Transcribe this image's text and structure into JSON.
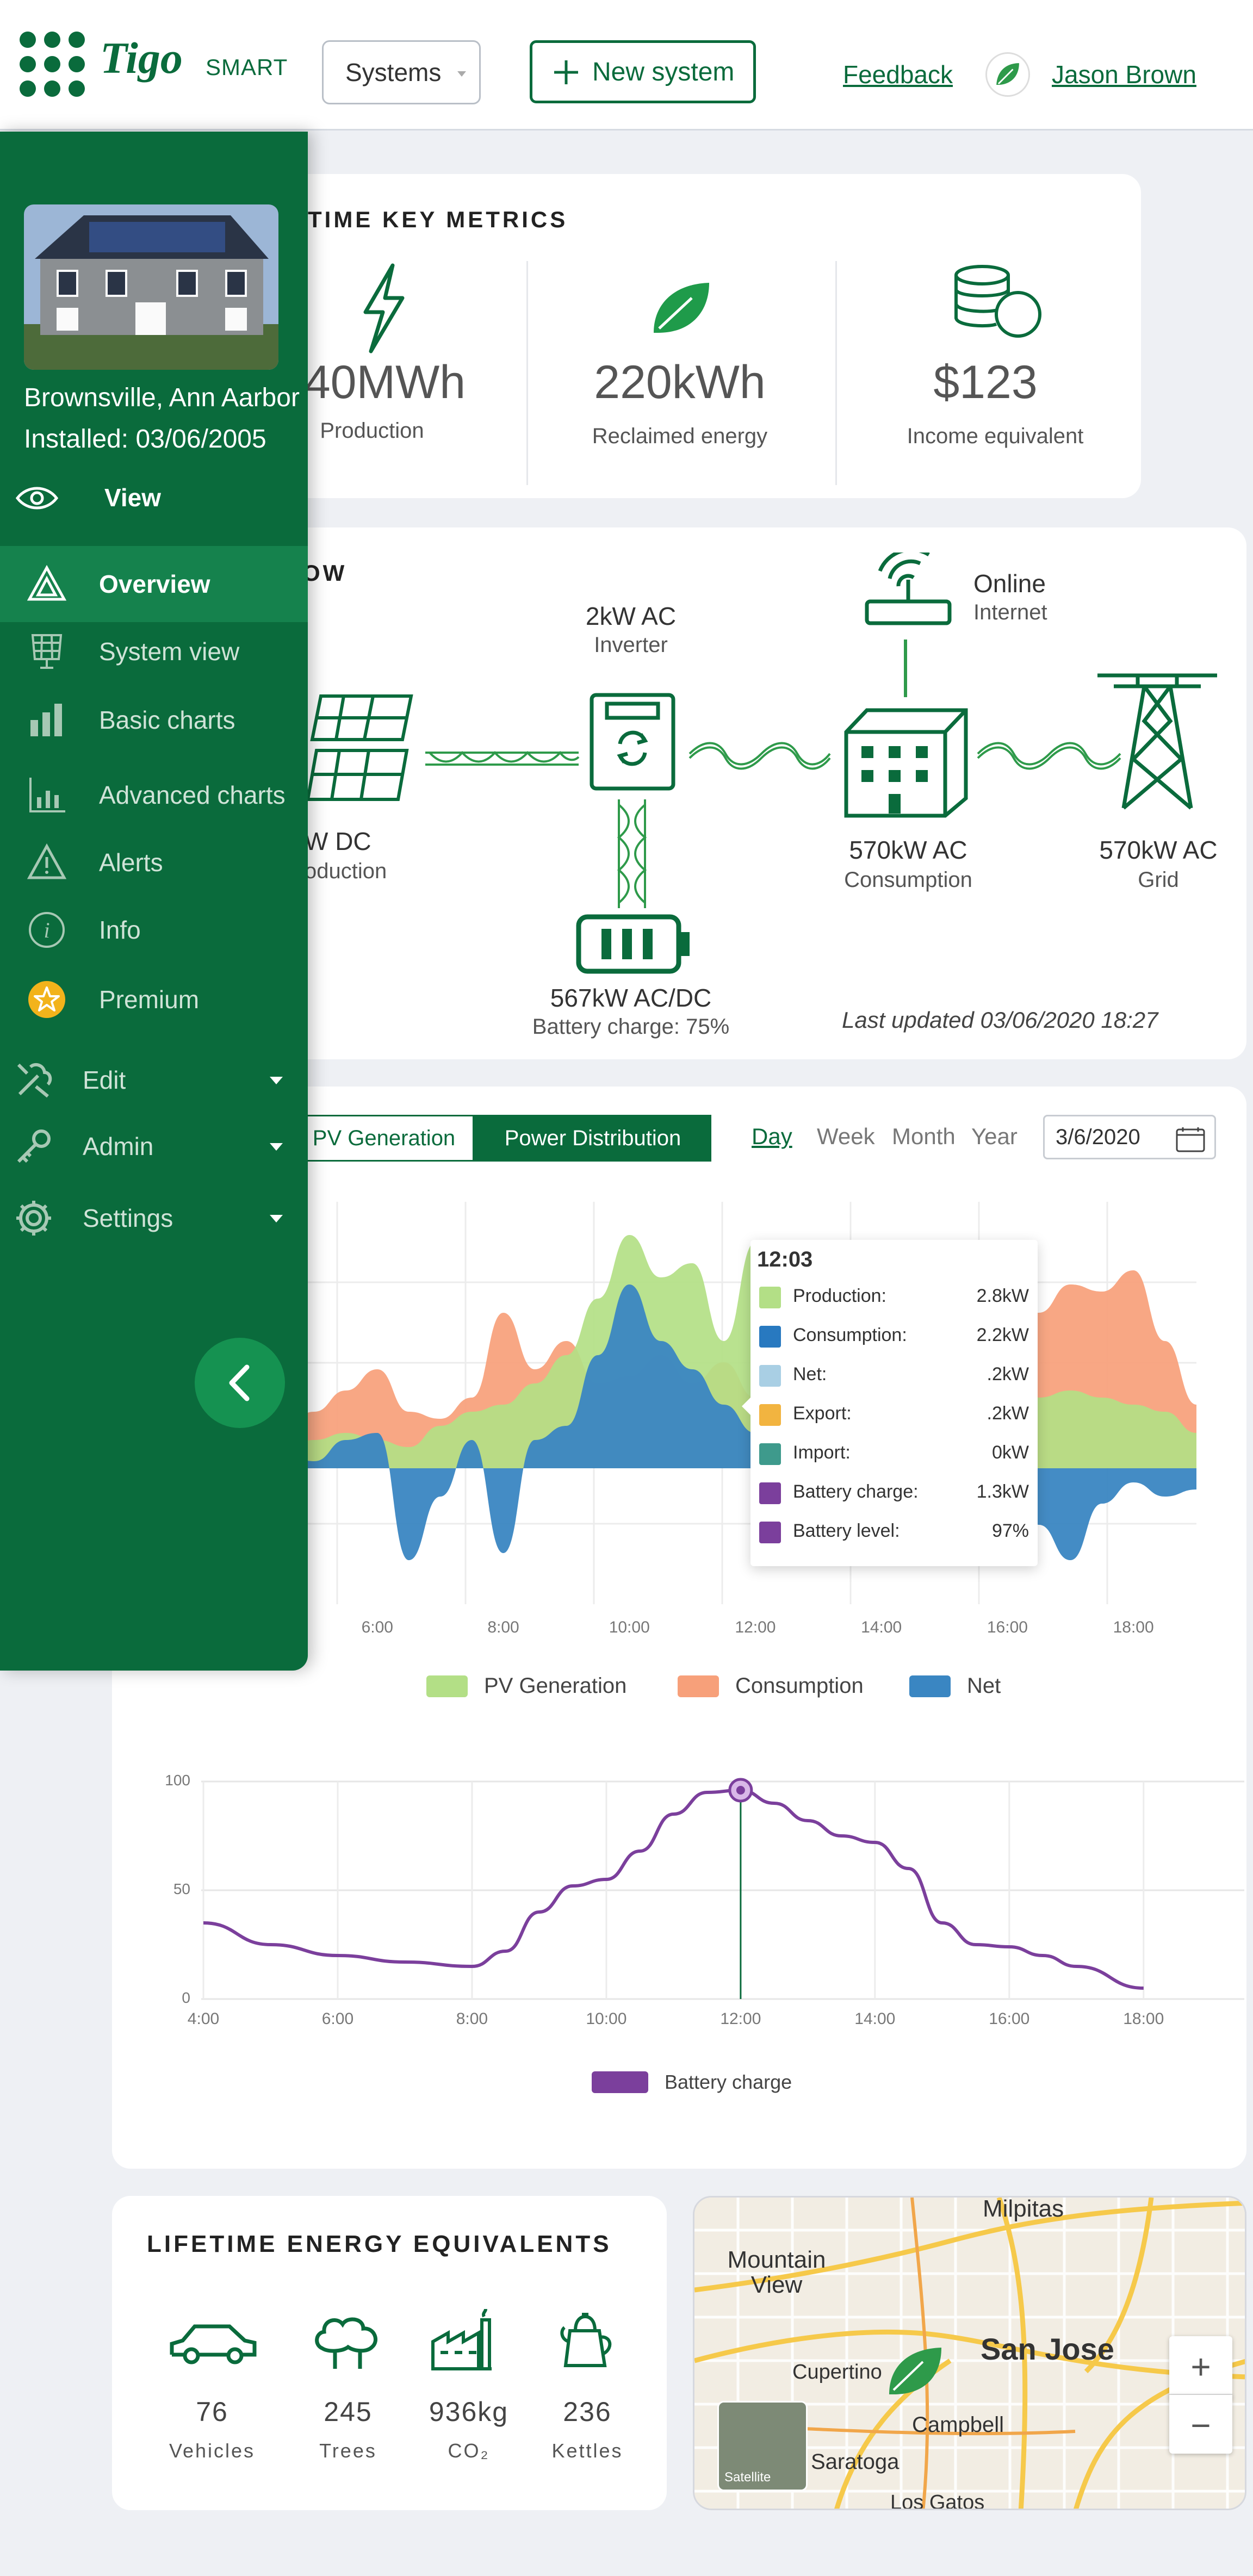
{
  "header": {
    "brand": "Tigo",
    "brand_sub": "SMART",
    "systems_label": "Systems",
    "new_system_label": "New system",
    "feedback_label": "Feedback",
    "user_name": "Jason Brown"
  },
  "sidebar": {
    "location": "Brownsville, Ann Aarbor",
    "installed": "Installed: 03/06/2005",
    "view_label": "View",
    "items": [
      {
        "label": "Overview",
        "icon": "overview-icon",
        "active": true
      },
      {
        "label": "System view",
        "icon": "solar-panel-icon"
      },
      {
        "label": "Basic charts",
        "icon": "bar-chart-icon"
      },
      {
        "label": "Advanced charts",
        "icon": "advanced-chart-icon"
      },
      {
        "label": "Alerts",
        "icon": "warning-icon"
      },
      {
        "label": "Info",
        "icon": "info-icon"
      },
      {
        "label": "Premium",
        "icon": "star-icon"
      },
      {
        "label": "Edit",
        "icon": "tools-icon",
        "dropdown": true
      },
      {
        "label": "Admin",
        "icon": "key-icon",
        "dropdown": true
      },
      {
        "label": "Settings",
        "icon": "gear-icon",
        "dropdown": true
      }
    ]
  },
  "metrics": {
    "title": "TIME KEY METRICS",
    "items": [
      {
        "value": "40MWh",
        "label": "Production",
        "icon": "lightning-icon"
      },
      {
        "value": "220kWh",
        "label": "Reclaimed energy",
        "icon": "leaf-icon"
      },
      {
        "value": "$123",
        "label": "Income equivalent",
        "icon": "coins-icon"
      }
    ]
  },
  "flow": {
    "title": "OW",
    "production_value": "W DC",
    "production_label": "oduction",
    "inverter_value": "2kW AC",
    "inverter_label": "Inverter",
    "internet_status": "Online",
    "internet_label": "Internet",
    "consumption_value": "570kW AC",
    "consumption_label": "Consumption",
    "grid_value": "570kW AC",
    "grid_label": "Grid",
    "battery_value": "567kW AC/DC",
    "battery_label": "Battery charge: 75%",
    "last_updated": "Last updated 03/06/2020 18:27"
  },
  "chart_controls": {
    "tabs": [
      "PV Generation",
      "Power Distribution"
    ],
    "active_tab": "Power Distribution",
    "periods": [
      "Day",
      "Week",
      "Month",
      "Year"
    ],
    "active_period": "Day",
    "date": "3/6/2020"
  },
  "tooltip": {
    "time": "12:03",
    "rows": [
      {
        "label": "Production:",
        "value": "2.8kW",
        "color": "#b3df86"
      },
      {
        "label": "Consumption:",
        "value": "2.2kW",
        "color": "#2879c0"
      },
      {
        "label": "Net:",
        "value": ".2kW",
        "color": "#a9cfe4"
      },
      {
        "label": "Export:",
        "value": ".2kW",
        "color": "#f2b440"
      },
      {
        "label": "Import:",
        "value": "0kW",
        "color": "#3e9a8c"
      },
      {
        "label": "Battery charge:",
        "value": "1.3kW",
        "color": "#7b3f9c"
      },
      {
        "label": "Battery level:",
        "value": "97%",
        "color": "#7b3f9c"
      }
    ]
  },
  "chart_data": [
    {
      "type": "area",
      "x_ticks": [
        "6:00",
        "8:00",
        "10:00",
        "12:00",
        "14:00",
        "16:00",
        "18:00"
      ],
      "x": [
        4.5,
        5,
        5.5,
        6,
        6.5,
        7,
        7.5,
        8,
        8.5,
        9,
        9.5,
        10,
        10.5,
        11,
        11.5,
        12,
        12.5,
        13,
        13.5,
        14,
        14.5,
        15,
        15.5,
        16,
        16.5,
        17,
        17.5,
        18,
        18.5,
        19
      ],
      "series": [
        {
          "name": "PV Generation",
          "color": "#b3df86",
          "values": [
            0.3,
            0.4,
            0.5,
            0.4,
            0.3,
            0.6,
            0.8,
            0.9,
            1.2,
            1.6,
            2.4,
            3.3,
            2.7,
            2.9,
            1.8,
            3.2,
            1.0,
            1.2,
            1.5,
            1.3,
            1.1,
            1.2,
            1.4,
            1.2,
            1.0,
            1.1,
            1.0,
            0.9,
            0.8,
            0.5
          ]
        },
        {
          "name": "Consumption",
          "color": "#f7a07a",
          "values": [
            0.6,
            0.8,
            1.1,
            1.4,
            0.8,
            0.7,
            1.0,
            2.2,
            1.4,
            1.8,
            1.2,
            1.3,
            1.6,
            1.2,
            1.5,
            1.0,
            1.3,
            1.2,
            1.6,
            1.3,
            1.0,
            1.0,
            1.4,
            1.8,
            2.2,
            2.6,
            2.5,
            2.8,
            1.8,
            0.9
          ]
        },
        {
          "name": "Net",
          "color": "#3a86c2",
          "values": [
            0.2,
            0.1,
            0.4,
            0.5,
            -1.3,
            -0.4,
            0.4,
            -1.2,
            0.4,
            0.6,
            1.6,
            2.6,
            1.8,
            1.4,
            0.9,
            0.5,
            0.3,
            0.4,
            0.6,
            0.5,
            0.3,
            -0.5,
            -0.3,
            0.4,
            -0.8,
            -1.3,
            -0.5,
            -0.2,
            -0.4,
            -0.3
          ]
        }
      ]
    },
    {
      "type": "line",
      "x_ticks": [
        "4:00",
        "6:00",
        "8:00",
        "10:00",
        "12:00",
        "14:00",
        "16:00",
        "18:00"
      ],
      "y_ticks": [
        "0",
        "50",
        "100"
      ],
      "ylim": [
        0,
        100
      ],
      "x": [
        4,
        5,
        6,
        7,
        8,
        8.5,
        9,
        9.5,
        10,
        10.5,
        11,
        11.5,
        12,
        12.5,
        13,
        13.5,
        14,
        14.5,
        15,
        15.5,
        16,
        16.5,
        17,
        18
      ],
      "series": [
        {
          "name": "Battery charge",
          "color": "#7b3f9c",
          "values": [
            35,
            25,
            20,
            17,
            15,
            22,
            40,
            52,
            55,
            68,
            85,
            95,
            96,
            90,
            82,
            75,
            72,
            60,
            35,
            25,
            24,
            20,
            15,
            5
          ]
        }
      ],
      "marker": {
        "x": 12,
        "y": 96
      }
    }
  ],
  "legend1": [
    "PV Generation",
    "Consumption",
    "Net"
  ],
  "legend2": [
    "Battery charge"
  ],
  "equivalents": {
    "title": "LIFETIME ENERGY EQUIVALENTS",
    "items": [
      {
        "value": "76",
        "label": "Vehicles",
        "icon": "car-icon"
      },
      {
        "value": "245",
        "label": "Trees",
        "icon": "trees-icon"
      },
      {
        "value": "936kg",
        "label": "CO₂",
        "icon": "factory-icon"
      },
      {
        "value": "236",
        "label": "Kettles",
        "icon": "kettle-icon"
      }
    ]
  },
  "map": {
    "labels": [
      "Milpitas",
      "Mountain View",
      "San Jose",
      "Cupertino",
      "Campbell",
      "Saratoga",
      "Los Gatos"
    ],
    "satellite_label": "Satellite",
    "zoom_in": "+",
    "zoom_out": "−"
  }
}
